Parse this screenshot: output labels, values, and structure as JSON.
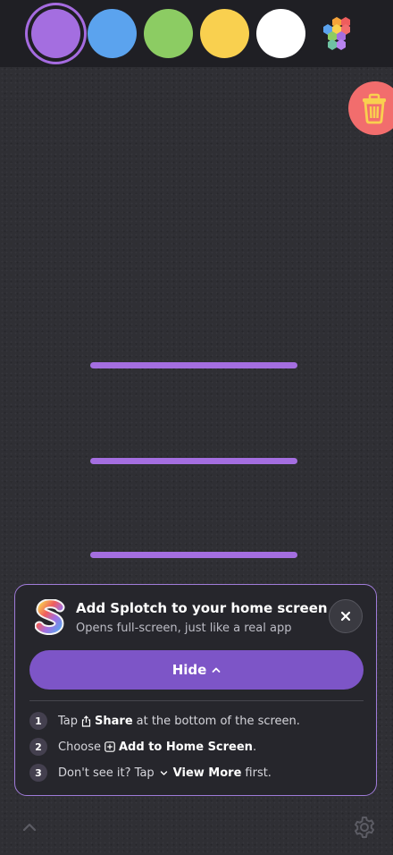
{
  "palette": {
    "colors": [
      {
        "name": "purple",
        "hex": "#a46ee0",
        "selected": true
      },
      {
        "name": "blue",
        "hex": "#5ba3ee",
        "selected": false
      },
      {
        "name": "green",
        "hex": "#8ccc63",
        "selected": false
      },
      {
        "name": "yellow",
        "hex": "#f9d04f",
        "selected": false
      },
      {
        "name": "white",
        "hex": "#ffffff",
        "selected": false
      }
    ],
    "more_colors_icon": "hexagon-palette-icon"
  },
  "toolbar": {
    "trash_icon": "trash-icon",
    "trash_color": "#f26d6d"
  },
  "canvas": {
    "stroke_color": "#a46ee0",
    "stroke_count": 3
  },
  "install_prompt": {
    "title": "Add Splotch to your home screen",
    "subtitle": "Opens full-screen, just like a real app",
    "hide_label": "Hide",
    "steps": [
      {
        "num": "1",
        "pre": "Tap",
        "bold": "Share",
        "post": "at the bottom of the screen.",
        "icon": "share-icon"
      },
      {
        "num": "2",
        "pre": "Choose",
        "bold": "Add to Home Screen",
        "post": ".",
        "icon": "add-square-icon"
      },
      {
        "num": "3",
        "pre": "Don't see it? Tap",
        "bold": "View More",
        "post": "first.",
        "icon": "chevron-down-icon"
      }
    ]
  },
  "footer": {
    "collapse_icon": "chevron-up-icon",
    "settings_icon": "gear-icon"
  }
}
